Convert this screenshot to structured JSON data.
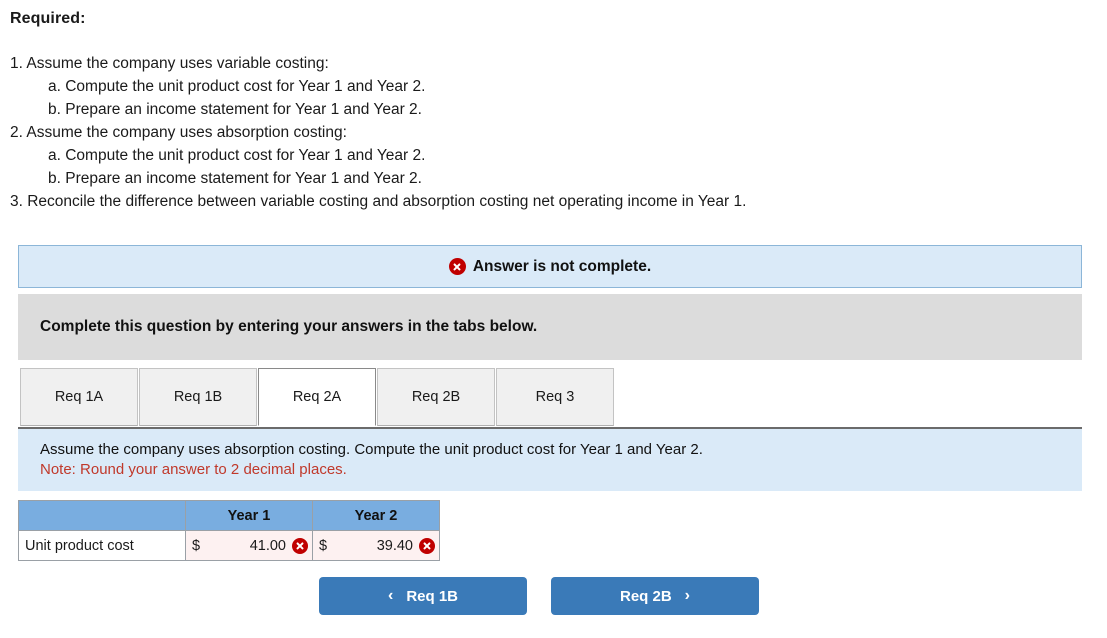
{
  "header": {
    "required_label": "Required:"
  },
  "requirements": [
    {
      "indent": 0,
      "text": "1. Assume the company uses variable costing:"
    },
    {
      "indent": 2,
      "text": "a. Compute the unit product cost for Year 1 and Year 2."
    },
    {
      "indent": 2,
      "text": "b. Prepare an income statement for Year 1 and Year 2."
    },
    {
      "indent": 0,
      "text": "2. Assume the company uses absorption costing:"
    },
    {
      "indent": 2,
      "text": "a. Compute the unit product cost for Year 1 and Year 2."
    },
    {
      "indent": 2,
      "text": "b. Prepare an income statement for Year 1 and Year 2."
    },
    {
      "indent": 0,
      "text": "3. Reconcile the difference between variable costing and absorption costing net operating income in Year 1."
    }
  ],
  "status_banner": {
    "icon": "error-x-circle-icon",
    "text": "Answer is not complete."
  },
  "grey_bar": {
    "text": "Complete this question by entering your answers in the tabs below."
  },
  "tabs": [
    {
      "label": "Req 1A",
      "active": false
    },
    {
      "label": "Req 1B",
      "active": false
    },
    {
      "label": "Req 2A",
      "active": true
    },
    {
      "label": "Req 2B",
      "active": false
    },
    {
      "label": "Req 3",
      "active": false
    }
  ],
  "instruction_panel": {
    "line1": "Assume the company uses absorption costing. Compute the unit product cost for Year 1 and Year 2.",
    "note": "Note: Round your answer to 2 decimal places."
  },
  "answer_table": {
    "columns": [
      "",
      "Year 1",
      "Year 2"
    ],
    "rows": [
      {
        "label": "Unit product cost",
        "cells": [
          {
            "currency": "$",
            "value": "41.00",
            "status": "incorrect",
            "status_icon": "error-x-circle-icon"
          },
          {
            "currency": "$",
            "value": "39.40",
            "status": "incorrect",
            "status_icon": "error-x-circle-icon"
          }
        ]
      }
    ]
  },
  "nav": {
    "prev": {
      "label": "Req 1B",
      "icon": "chevron-left-icon",
      "glyph": "‹"
    },
    "next": {
      "label": "Req 2B",
      "icon": "chevron-right-icon",
      "glyph": "›"
    }
  },
  "colors": {
    "banner_bg": "#daeaf8",
    "banner_border": "#8cb6d8",
    "grey_bar_bg": "#dcdcdc",
    "table_header_blue": "#79ade0",
    "incorrect_cell_bg": "#fdf1f1",
    "error_red": "#c00000",
    "note_red": "#c0392b",
    "button_blue": "#3a7ab8",
    "active_tab_bg": "#ffffff",
    "inactive_tab_bg": "#f0f0f0"
  }
}
